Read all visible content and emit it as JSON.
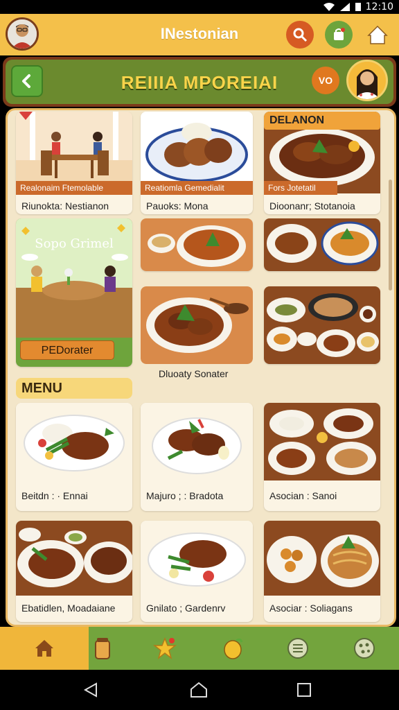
{
  "status_bar": {
    "time": "12:10"
  },
  "header": {
    "title": "INestonian"
  },
  "sub_header": {
    "title": "REIIIA MPOREIAI",
    "badge": "VO"
  },
  "row1": [
    {
      "strip": "Realonaim Ftemolable",
      "label": "Riunokta: Nestianon"
    },
    {
      "strip": "Reatiomla Gemedialit",
      "label": "Pauoks: Mona"
    },
    {
      "tag": "DELANON",
      "strip": "Fors Jotetatil",
      "label": "Dioonanr; Stotanoia"
    }
  ],
  "promo": {
    "title": "Sopo Grimel",
    "button": "PEDorater"
  },
  "row3_label": "Dluoaty Sonater",
  "menu_title": "MENU",
  "menu_items": [
    {
      "label": "Beitdn : · Ennai"
    },
    {
      "label": "Majuro ; : Bradota"
    },
    {
      "label": "Asocian : Sanoi"
    },
    {
      "label": "Ebatidlen, Moadaiane"
    },
    {
      "label": "Gnilato ; Gardenrv"
    },
    {
      "label": "Asociar : Soliagans"
    }
  ],
  "colors": {
    "header_bg": "#f4c04a",
    "sub_header_bg": "#6b8a2e",
    "accent_orange": "#cb6a2b",
    "nav_bg": "#73a43d",
    "nav_active": "#f0b63a"
  },
  "icons": {
    "header": [
      "search-icon",
      "shopping-bag-icon",
      "home-icon"
    ],
    "nav": [
      "home-icon",
      "jar-icon",
      "star-icon",
      "lemon-icon",
      "menu-list-icon",
      "cookie-icon"
    ],
    "system": [
      "back-triangle-icon",
      "home-circle-icon",
      "recents-square-icon"
    ]
  }
}
